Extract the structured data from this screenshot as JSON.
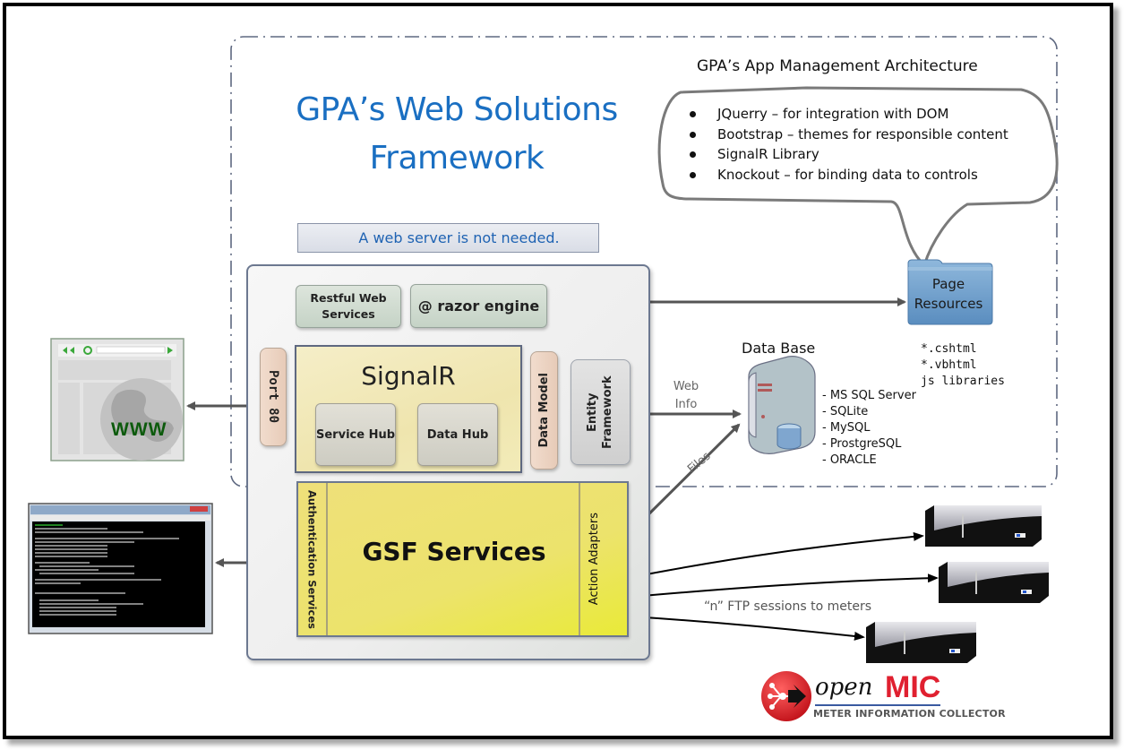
{
  "diagram": {
    "title_line1": "GPA’s Web Solutions",
    "title_line2": "Framework",
    "note": "A web server is not needed.",
    "app_management": {
      "title": "GPA’s App Management Architecture",
      "items": [
        "JQuerry – for integration with DOM",
        "Bootstrap – themes for responsible content",
        "SignalR Library",
        "Knockout – for binding data to controls"
      ]
    },
    "server": {
      "restful": "Restful Web Services",
      "razor": "@ razor engine",
      "port": "Port 80",
      "signalr": {
        "title": "SignalR",
        "service_hub": "Service Hub",
        "data_hub": "Data Hub"
      },
      "data_model": "Data Model",
      "entity_framework": "Entity Framework",
      "gsf": {
        "title": "GSF Services",
        "auth": "Authentication Services",
        "action_adapters": "Action Adapters"
      }
    },
    "page_resources": {
      "label_line1": "Page",
      "label_line2": "Resources",
      "files": [
        "*.cshtml",
        "*.vbhtml",
        "js libraries"
      ]
    },
    "database": {
      "title": "Data Base",
      "engines": [
        "- MS SQL Server",
        "- SQLite",
        "- MySQL",
        "- ProstgreSQL",
        "- ORACLE"
      ]
    },
    "connections": {
      "web_info_line1": "Web",
      "web_info_line2": "Info",
      "files": "Files",
      "ftp": "“n” FTP sessions to meters"
    },
    "browser": {
      "label": "WWW"
    },
    "logo": {
      "open": "open",
      "mic": "MIC",
      "subtitle": "METER INFORMATION COLLECTOR"
    },
    "colors": {
      "title_blue": "#1a6fc2",
      "signalr_yellow": "#efe5ae",
      "gsf_yellow": "#ece36c",
      "folder_blue": "#6f9fcb",
      "logo_red": "#e02030"
    }
  }
}
